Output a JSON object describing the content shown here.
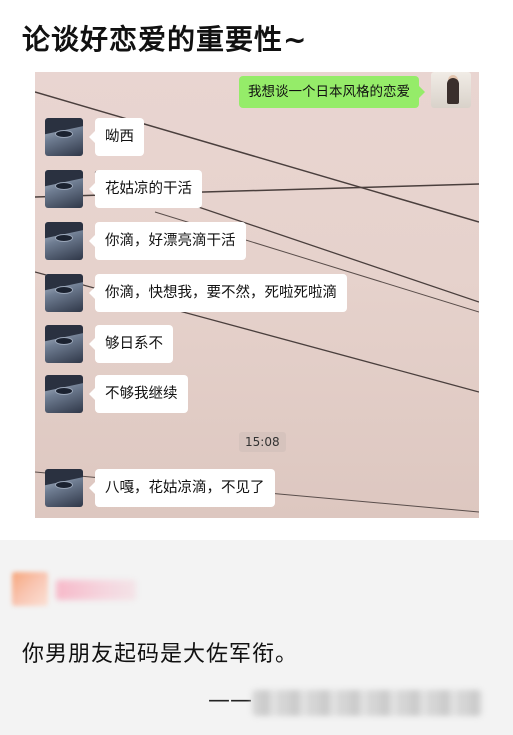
{
  "post": {
    "title": "论谈好恋爱的重要性~"
  },
  "chat": {
    "my_message": "我想谈一个日本风格的恋爱",
    "messages": [
      "呦西",
      "花姑凉的干活",
      "你滴，好漂亮滴干活",
      "你滴，快想我，要不然，死啦死啦滴",
      "够日系不",
      "不够我继续"
    ],
    "timestamp": "15:08",
    "last_message": "八嘎，花姑凉滴，不见了"
  },
  "comment": {
    "text": "你男朋友起码是大佐军衔。",
    "signature_prefix": "——"
  },
  "colors": {
    "my_bubble": "#95ec69",
    "their_bubble": "#ffffff",
    "chat_background": "#e7d3ce",
    "comment_background": "#f3f3f3"
  }
}
